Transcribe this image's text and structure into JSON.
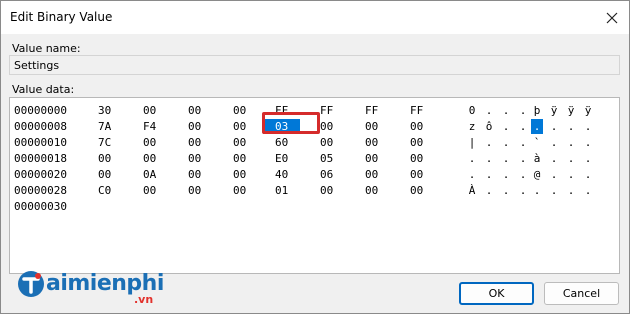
{
  "window": {
    "title": "Edit Binary Value"
  },
  "value_name": {
    "label": "Value name:",
    "value": "Settings"
  },
  "value_data": {
    "label": "Value data:",
    "rows": [
      {
        "offset": "00000000",
        "bytes": [
          "30",
          "00",
          "00",
          "00",
          "FF",
          "FF",
          "FF",
          "FF"
        ],
        "ascii": [
          "0",
          ".",
          ".",
          ".",
          "þ",
          "ÿ",
          "ÿ",
          "ÿ"
        ]
      },
      {
        "offset": "00000008",
        "bytes": [
          "7A",
          "F4",
          "00",
          "00",
          "03",
          "00",
          "00",
          "00"
        ],
        "ascii": [
          "z",
          "ô",
          ".",
          ".",
          ".",
          ".",
          ".",
          "."
        ]
      },
      {
        "offset": "00000010",
        "bytes": [
          "7C",
          "00",
          "00",
          "00",
          "60",
          "00",
          "00",
          "00"
        ],
        "ascii": [
          "|",
          ".",
          ".",
          ".",
          "`",
          ".",
          ".",
          "."
        ]
      },
      {
        "offset": "00000018",
        "bytes": [
          "00",
          "00",
          "00",
          "00",
          "E0",
          "05",
          "00",
          "00"
        ],
        "ascii": [
          ".",
          ".",
          ".",
          ".",
          "à",
          ".",
          ".",
          "."
        ]
      },
      {
        "offset": "00000020",
        "bytes": [
          "00",
          "0A",
          "00",
          "00",
          "40",
          "06",
          "00",
          "00"
        ],
        "ascii": [
          ".",
          ".",
          ".",
          ".",
          "@",
          ".",
          ".",
          "."
        ]
      },
      {
        "offset": "00000028",
        "bytes": [
          "C0",
          "00",
          "00",
          "00",
          "01",
          "00",
          "00",
          "00"
        ],
        "ascii": [
          "À",
          ".",
          ".",
          ".",
          ".",
          ".",
          ".",
          "."
        ]
      },
      {
        "offset": "00000030",
        "bytes": [],
        "ascii": []
      }
    ],
    "selected": {
      "row": 1,
      "col": 4
    }
  },
  "buttons": {
    "ok": "OK",
    "cancel": "Cancel"
  },
  "watermark": {
    "brand": "aimienphi",
    "domain": ".vn"
  },
  "colors": {
    "selection": "#0078d7",
    "highlight": "#d52b2b",
    "ok_border": "#0067c0"
  }
}
